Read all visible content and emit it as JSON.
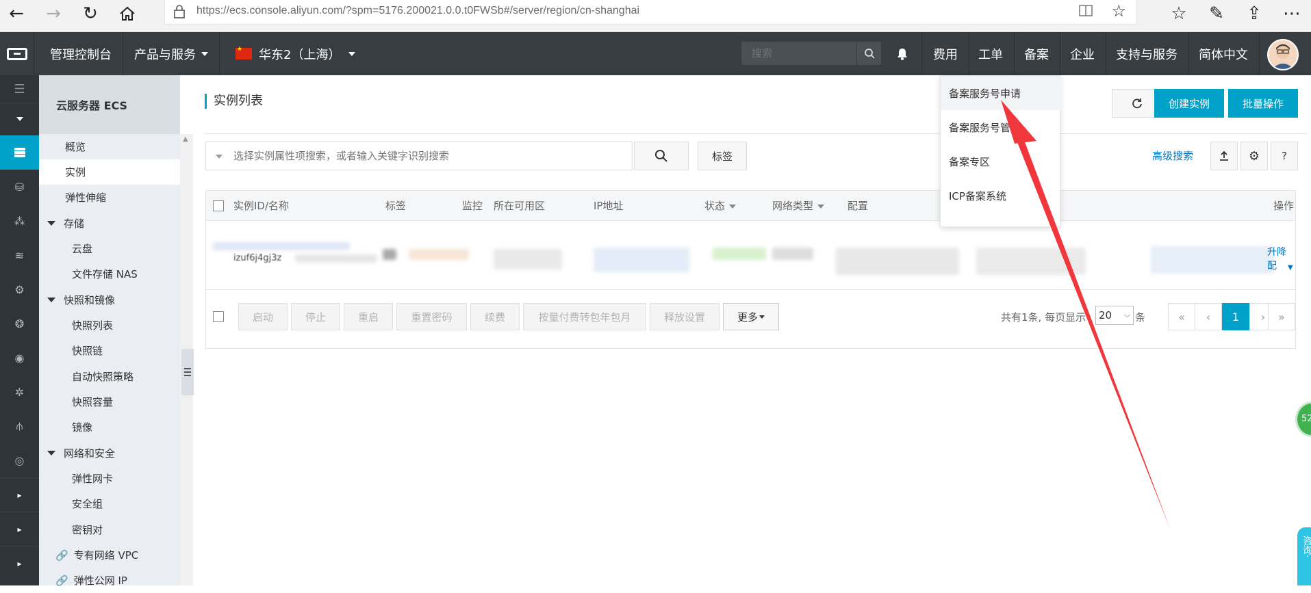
{
  "browser": {
    "url": "https://ecs.console.aliyun.com/?spm=5176.200021.0.0.t0FWSb#/server/region/cn-shanghai"
  },
  "topnav": {
    "console": "管理控制台",
    "products": "产品与服务",
    "region": "华东2（上海）",
    "search_placeholder": "搜索",
    "links": [
      "费用",
      "工单",
      "备案",
      "企业",
      "支持与服务",
      "简体中文"
    ]
  },
  "sidebar": {
    "title": "云服务器 ECS",
    "items": [
      {
        "label": "概览",
        "level": 1
      },
      {
        "label": "实例",
        "level": 1,
        "active": true
      },
      {
        "label": "弹性伸缩",
        "level": 1
      },
      {
        "label": "存储",
        "level": 0
      },
      {
        "label": "云盘",
        "level": 2
      },
      {
        "label": "文件存储 NAS",
        "level": 2
      },
      {
        "label": "快照和镜像",
        "level": 0
      },
      {
        "label": "快照列表",
        "level": 2
      },
      {
        "label": "快照链",
        "level": 2
      },
      {
        "label": "自动快照策略",
        "level": 2
      },
      {
        "label": "快照容量",
        "level": 2
      },
      {
        "label": "镜像",
        "level": 2
      },
      {
        "label": "网络和安全",
        "level": 0
      },
      {
        "label": "弹性网卡",
        "level": 2
      },
      {
        "label": "安全组",
        "level": 2
      },
      {
        "label": "密钥对",
        "level": 2
      },
      {
        "label": "专有网络 VPC",
        "level": 3
      },
      {
        "label": "弹性公网 IP",
        "level": 3
      }
    ]
  },
  "main": {
    "title": "实例列表",
    "create_button": "创建实例",
    "batch_button": "批量操作",
    "filter_placeholder": "选择实例属性项搜索，或者输入关键字识别搜索",
    "tag_button": "标签",
    "advanced_search": "高级搜索",
    "help": "?",
    "columns": [
      "实例ID/名称",
      "标签",
      "监控",
      "所在可用区",
      "IP地址",
      "状态",
      "网络类型",
      "配置",
      "操作"
    ],
    "row": {
      "id_partial": "i-uf6....",
      "name_partial": "izuf6j4gj3z",
      "action_partial": "升降配"
    },
    "footer_buttons": [
      "启动",
      "停止",
      "重启",
      "重置密码",
      "续费",
      "按量付费转包年包月",
      "释放设置"
    ],
    "more_button": "更多",
    "pager_text": "共有1条, 每页显示",
    "page_size": "20",
    "page_unit": "条",
    "pages": [
      "«",
      "‹",
      "1",
      "›",
      "»"
    ],
    "current_page": "1"
  },
  "dropdown": {
    "items": [
      "备案服务号申请",
      "备案服务号管理",
      "备案专区",
      "ICP备案系统"
    ]
  },
  "floating": {
    "badge": "52",
    "consult": "咨询·"
  },
  "colors": {
    "accent": "#00a2ca",
    "nav_bg": "#373d41",
    "rail_bg": "#2f3438",
    "sidebar_bg": "#eaedf1",
    "annotation_arrow": "#f0373b"
  }
}
